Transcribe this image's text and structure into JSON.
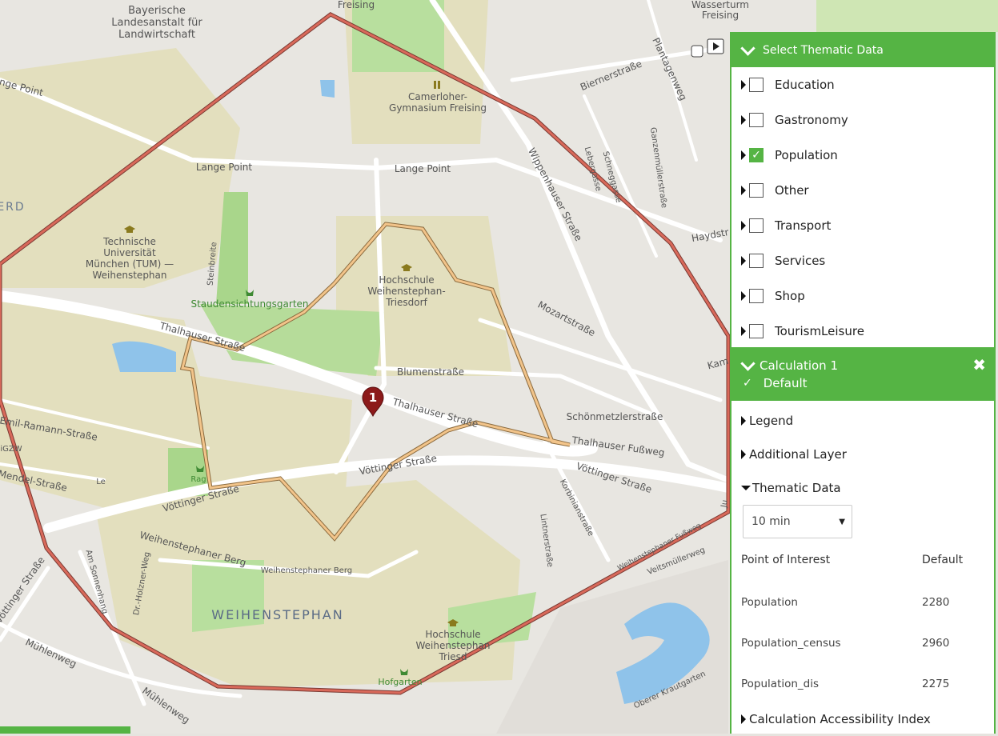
{
  "map": {
    "labels": {
      "bayerische": [
        "Bayerische",
        "Landesanstalt für",
        "Landwirtschaft"
      ],
      "freising_top": "Freising",
      "wasserturm": [
        "Wasserturm",
        "Freising"
      ],
      "camerloher": [
        "Camerloher-",
        "Gymnasium Freising"
      ],
      "biernerstrasse": "Biernerstraße",
      "plantagenweg": "Plantagenweg",
      "lange_point_1": "ange Point",
      "lange_point_2": "Lange Point",
      "lange_point_3": "Lange Point",
      "wippenhauser": "Wippenhauser Straße",
      "lebergasse": "Lebergasse",
      "schneggasse": "Schneggasse",
      "ganzenmueller": "Ganzenmüllerstraße",
      "haydstr": "Haydstr",
      "erd": "ERD",
      "tum": [
        "Technische",
        "Universität",
        "München (TUM) —",
        "Weihenstephan"
      ],
      "steinbreite": "Steinbreite",
      "hochschule_1": [
        "Hochschule",
        "Weihenstephan-",
        "Triesdorf"
      ],
      "staudensichtungsgarten": "Staudensichtungsgarten",
      "thalhauser_1": "Thalhauser Straße",
      "mozartstrasse": "Mozartstraße",
      "blumenstrasse": "Blumenstraße",
      "kam": "Kam",
      "thalhauser_2": "Thalhauser Straße",
      "schoenmetzler": "Schönmetzlerstraße",
      "thalhauser_fussweg": "Thalhauser Fußweg",
      "emil_ramann": "Emil-Ramann-Straße",
      "mendel": "Mendel-Straße",
      "voettinger_1": "Vöttinger Straße",
      "voettinger_2": "Vöttinger Straße",
      "voettinger_3": "Vöttinger Straße",
      "voettinger_4": "Vöttinger Straße",
      "korbinian": "Korbinianstraße",
      "lintner": "Lintnerstraße",
      "weihenstephaner_fussweg": "Weihenstephaner Fußweg",
      "veitsmueller": "Veitsmüllerweg",
      "weihenstephaner_berg_1": "Weihenstephaner Berg",
      "weihenstephaner_berg_2": "Weihenstephaner Berg",
      "dr_holzner": "Dr.-Holzner-Weg",
      "am_sonnenhang": "Am Sonnenhang",
      "weihenstephan": "WEIHENSTEPHAN",
      "hochschule_2": [
        "Hochschule",
        "Weihenstephan",
        "Triesd"
      ],
      "hofgarten": "Hofgarten",
      "muehlenweg_1": "Mühlenweg",
      "muehlenweg_2": "Mühlenweg",
      "oberer_krautgarten": "Oberer Krautgarten",
      "rag": "Rag",
      "le": "Le",
      "igzw": "iGZW",
      "ju": "Ju"
    },
    "marker_label": "1",
    "colors": {
      "isochrone_large": "#d9695a",
      "isochrone_small": "#f2c48a",
      "marker": "#8c1a1a"
    }
  },
  "thematic_panel": {
    "title": "Select Thematic Data",
    "items": [
      {
        "label": "Education",
        "checked": false
      },
      {
        "label": "Gastronomy",
        "checked": false
      },
      {
        "label": "Population",
        "checked": true
      },
      {
        "label": "Other",
        "checked": false
      },
      {
        "label": "Transport",
        "checked": false
      },
      {
        "label": "Services",
        "checked": false
      },
      {
        "label": "Shop",
        "checked": false
      },
      {
        "label": "TourismLeisure",
        "checked": false
      }
    ]
  },
  "calculation_panel": {
    "title": "Calculation 1",
    "subtitle": "Default",
    "close_icon": "close-icon",
    "sections": {
      "legend": "Legend",
      "additional_layer": "Additional Layer",
      "thematic_data": "Thematic Data",
      "accessibility": "Calculation Accessibility Index"
    },
    "select_value": "10 min",
    "table": {
      "headers": [
        "Point of Interest",
        "Default"
      ],
      "rows": [
        [
          "Population",
          "2280"
        ],
        [
          "Population_census",
          "2960"
        ],
        [
          "Population_dis",
          "2275"
        ]
      ]
    }
  },
  "accent_color": "#55b444"
}
